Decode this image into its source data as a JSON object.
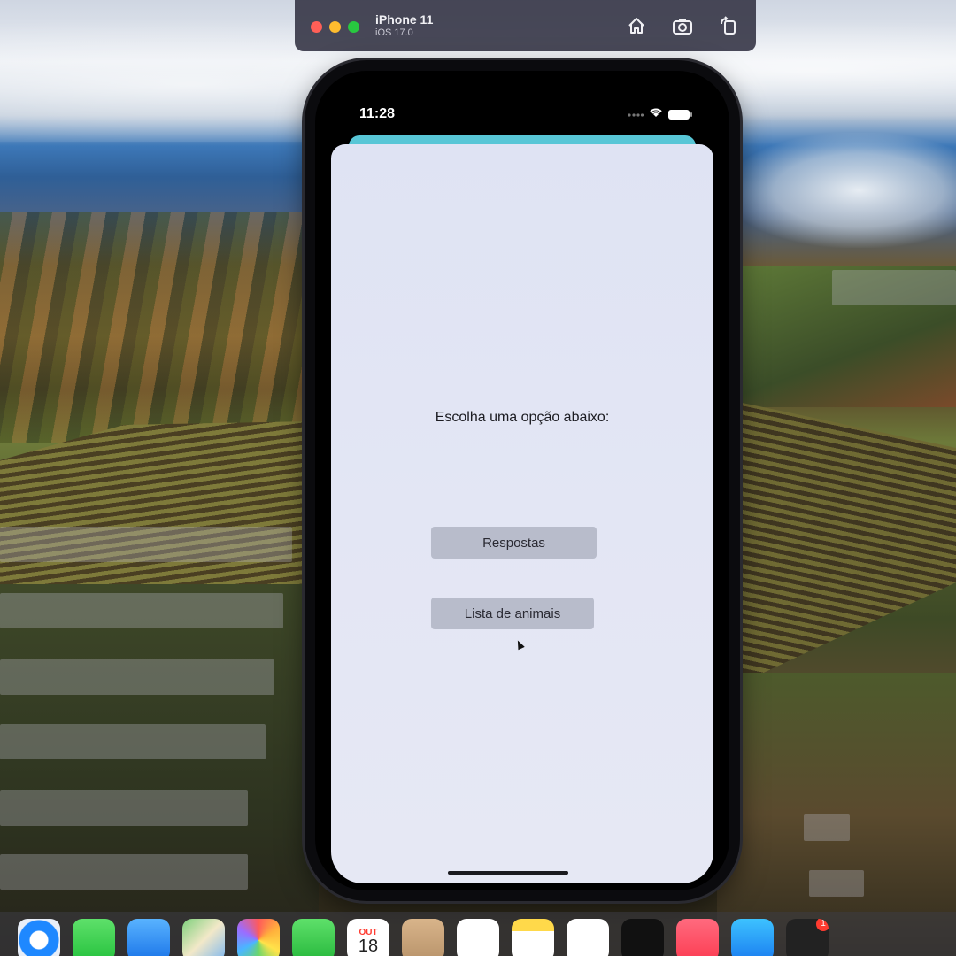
{
  "simulator": {
    "device_name": "iPhone 11",
    "os_version": "iOS 17.0",
    "actions": [
      {
        "name": "home-icon"
      },
      {
        "name": "screenshot-icon"
      },
      {
        "name": "rotate-icon"
      }
    ]
  },
  "phone": {
    "status_time": "11:28",
    "status_icons": [
      "signal-dots-icon",
      "wifi-icon",
      "battery-icon"
    ],
    "sheet_accent_color": "#58c6d6",
    "prompt": "Escolha uma opção abaixo:",
    "buttons": [
      {
        "label": "Respostas"
      },
      {
        "label": "Lista de animais"
      }
    ]
  },
  "dock": {
    "apps": [
      "safari-icon",
      "messages-icon",
      "mail-icon",
      "maps-icon",
      "photos-icon",
      "facetime-icon",
      "calendar-icon",
      "contacts-icon",
      "reminders-icon",
      "notes-icon",
      "freeform-icon",
      "tv-icon",
      "music-icon",
      "app-store-icon",
      "podcasts-icon"
    ],
    "calendar_month": "OUT",
    "calendar_day": "18",
    "podcasts_badge": "1"
  }
}
